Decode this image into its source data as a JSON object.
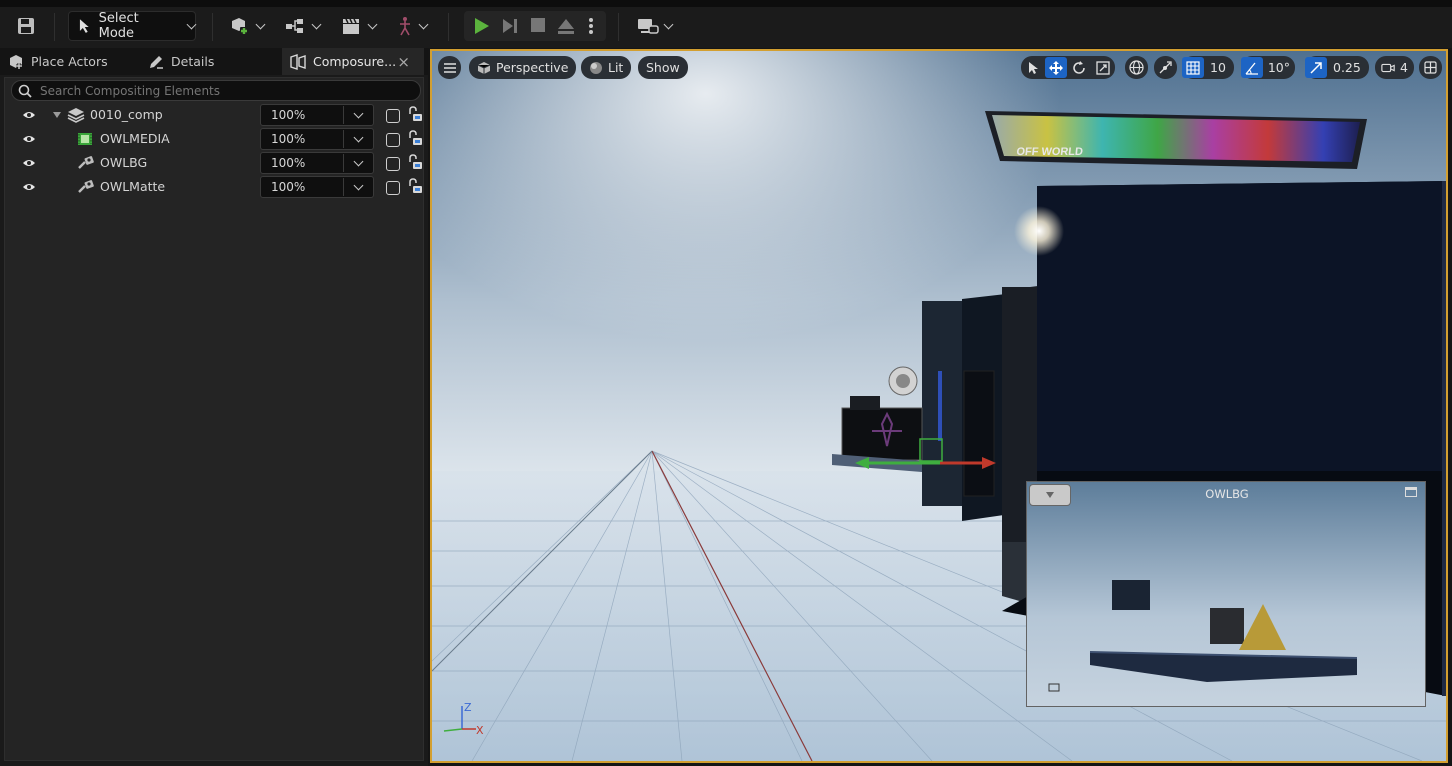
{
  "toolbar": {
    "mode_label": "Select Mode"
  },
  "tabs": [
    {
      "label": "Place Actors"
    },
    {
      "label": "Details"
    },
    {
      "label": "Composure..."
    }
  ],
  "composure": {
    "search_placeholder": "Search Compositing Elements",
    "elements": [
      {
        "name": "0010_comp",
        "opacity": "100%"
      },
      {
        "name": "OWLMEDIA",
        "opacity": "100%"
      },
      {
        "name": "OWLBG",
        "opacity": "100%"
      },
      {
        "name": "OWLMatte",
        "opacity": "100%"
      }
    ]
  },
  "viewport": {
    "view_mode": "Perspective",
    "lighting": "Lit",
    "show_label": "Show",
    "grid_snap": "10",
    "rotation_snap": "10°",
    "scale_snap": "0.25",
    "camera_speed": "4",
    "billboard_text": "OFF WORLD",
    "pip_title": "OWLBG",
    "axis_z": "Z",
    "axis_x": "X"
  },
  "colors": {
    "accent": "#d39f30",
    "play_green": "#5bb33d",
    "active_blue": "#1d64c4"
  }
}
